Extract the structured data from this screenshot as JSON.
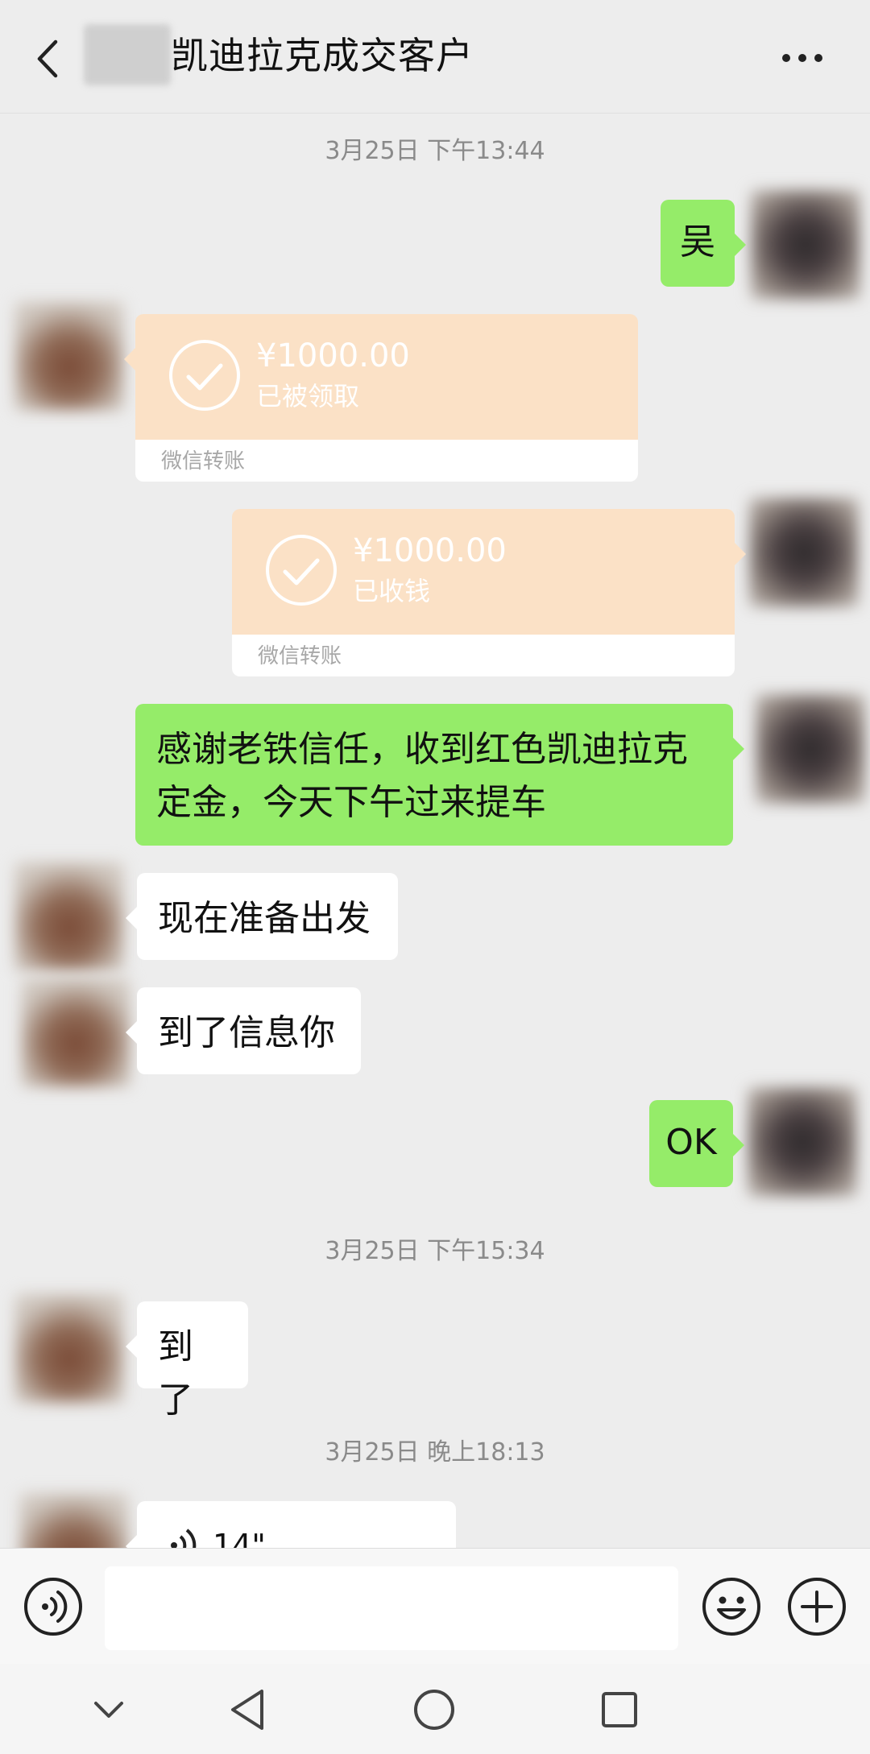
{
  "header": {
    "title": "凯迪拉克成交客户",
    "back_icon": "chevron-left-icon",
    "more_icon": "more-dots-icon"
  },
  "timestamps": {
    "t1": "3月25日 下午13:44",
    "t2": "3月25日 下午15:34",
    "t3": "3月25日 晚上18:13"
  },
  "messages": {
    "m1": "吴",
    "transfer1": {
      "amount": "¥1000.00",
      "status": "已被领取",
      "label": "微信转账"
    },
    "transfer2": {
      "amount": "¥1000.00",
      "status": "已收钱",
      "label": "微信转账"
    },
    "m2_line1": "感谢老铁信任，收到红色凯迪拉克",
    "m2_line2": "定金，今天下午过来提车",
    "m3": "现在准备出发",
    "m4": "到了信息你",
    "m5": "OK",
    "m6": "到了",
    "voice_duration": "14\""
  },
  "input_bar": {
    "placeholder": "",
    "voice_icon": "voice-icon",
    "emoji_icon": "emoji-icon",
    "plus_icon": "plus-icon"
  },
  "colors": {
    "background": "#ededed",
    "green_bubble": "#95ec69",
    "white_bubble": "#ffffff",
    "transfer_top": "#fbe1c6"
  }
}
